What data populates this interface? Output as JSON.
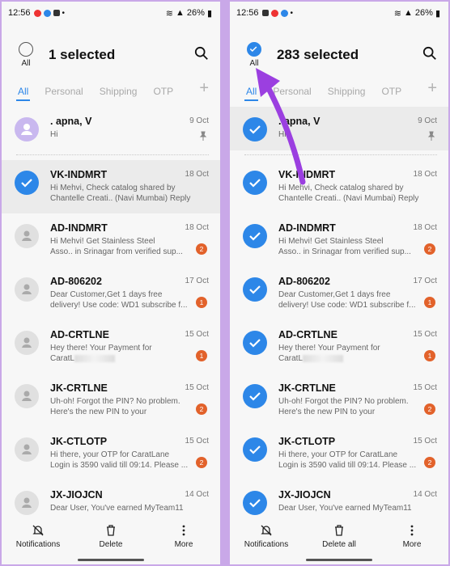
{
  "left": {
    "status": {
      "time": "12:56",
      "battery": "26%"
    },
    "header": {
      "all_label": "All",
      "title": "1 selected"
    },
    "tabs": [
      "All",
      "Personal",
      "Shipping",
      "OTP"
    ],
    "pinned": {
      "name": ". apna, V",
      "date": "9 Oct",
      "preview": "Hi"
    },
    "messages": [
      {
        "name": "VK-INDMRT",
        "date": "18 Oct",
        "line1": "Hi Mehvi, Check catalog shared by",
        "line2": "Chantelle Creati.. (Navi Mumbai) Reply ...",
        "badge": "",
        "selected": true
      },
      {
        "name": "AD-INDMRT",
        "date": "18 Oct",
        "line1": "Hi Mehvi! Get Stainless Steel",
        "line2": "Asso.. in Srinagar from verified sup...",
        "badge": "2",
        "selected": false
      },
      {
        "name": "AD-806202",
        "date": "17 Oct",
        "line1": "Dear Customer,Get 1 days free",
        "line2": "delivery! Use code: WD1 subscribe f...",
        "badge": "1",
        "selected": false
      },
      {
        "name": "AD-CRTLNE",
        "date": "15 Oct",
        "line1": "Hey there! Your Payment for",
        "line2": "CaratL",
        "badge": "1",
        "selected": false
      },
      {
        "name": "JK-CRTLNE",
        "date": "15 Oct",
        "line1": "Uh-oh! Forgot the PIN? No problem.",
        "line2": "Here's the new PIN to your CaratLane...",
        "badge": "2",
        "selected": false
      },
      {
        "name": "JK-CTLOTP",
        "date": "15 Oct",
        "line1": "Hi there, your OTP for CaratLane",
        "line2": "Login is 3590 valid till 09:14. Please ...",
        "badge": "2",
        "selected": false
      },
      {
        "name": "JX-JIOJCN",
        "date": "14 Oct",
        "line1": "Dear User,  You've earned MyTeam11",
        "line2": "",
        "badge": "",
        "selected": false
      }
    ],
    "bottom": {
      "b1": "Notifications",
      "b2": "Delete",
      "b3": "More"
    }
  },
  "right": {
    "status": {
      "time": "12:56",
      "battery": "26%"
    },
    "header": {
      "all_label": "All",
      "title": "283 selected"
    },
    "tabs": [
      "All",
      "Personal",
      "Shipping",
      "OTP"
    ],
    "pinned": {
      "name": ". apna, V",
      "date": "9 Oct",
      "preview": "Hi"
    },
    "messages": [
      {
        "name": "VK-INDMRT",
        "date": "18 Oct",
        "line1": "Hi Mehvi, Check catalog shared by",
        "line2": "Chantelle Creati.. (Navi Mumbai) Reply ...",
        "badge": ""
      },
      {
        "name": "AD-INDMRT",
        "date": "18 Oct",
        "line1": "Hi Mehvi! Get Stainless Steel",
        "line2": "Asso.. in Srinagar from verified sup...",
        "badge": "2"
      },
      {
        "name": "AD-806202",
        "date": "17 Oct",
        "line1": "Dear Customer,Get 1 days free",
        "line2": "delivery! Use code: WD1 subscribe f...",
        "badge": "1"
      },
      {
        "name": "AD-CRTLNE",
        "date": "15 Oct",
        "line1": "Hey there! Your Payment for",
        "line2": "CaratL",
        "badge": "1"
      },
      {
        "name": "JK-CRTLNE",
        "date": "15 Oct",
        "line1": "Uh-oh! Forgot the PIN? No problem.",
        "line2": "Here's the new PIN to your CaratLane...",
        "badge": "2"
      },
      {
        "name": "JK-CTLOTP",
        "date": "15 Oct",
        "line1": "Hi there, your OTP for CaratLane",
        "line2": "Login is 3590 valid till 09:14. Please ...",
        "badge": "2"
      },
      {
        "name": "JX-JIOJCN",
        "date": "14 Oct",
        "line1": "Dear User,  You've earned MyTeam11",
        "line2": "",
        "badge": ""
      }
    ],
    "bottom": {
      "b1": "Notifications",
      "b2": "Delete all",
      "b3": "More"
    }
  },
  "colors": {
    "accent": "#2d87e8",
    "badge": "#e2622b",
    "annotation_arrow": "#9b3fe0",
    "frame": "#c9a8e8"
  }
}
